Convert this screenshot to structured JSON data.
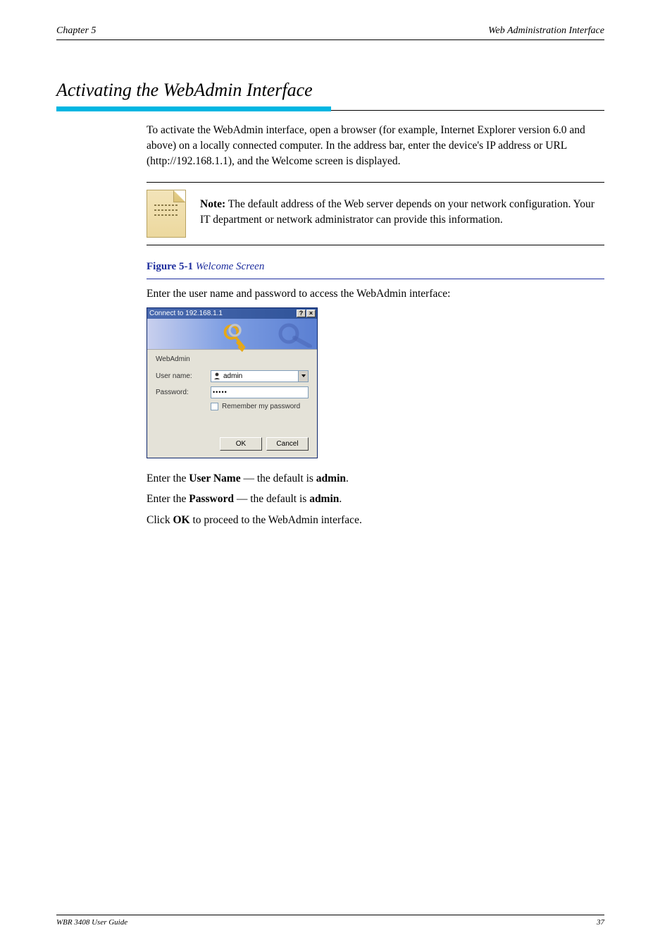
{
  "header": {
    "left": "Chapter 5",
    "right": "Web Administration Interface"
  },
  "section_title": "Activating the WebAdmin Interface",
  "body": {
    "p1_a": "To activate the WebAdmin interface, open a browser (for example, Internet Explorer version 6.0 and above) on a locally connected computer. In the address bar, enter the device's IP address or URL (",
    "p1_link": "http://192.168.1.1",
    "p1_b": "), and the Welcome screen is displayed."
  },
  "note": {
    "label": "Note:",
    "text": "The default address of the Web server depends on your network configuration. Your IT department or network administrator can provide this information."
  },
  "figure": {
    "num": "Figure 5-1",
    "caption": "Welcome Screen"
  },
  "step2": "Enter the user name and password to access the WebAdmin interface:",
  "dialog": {
    "title": "Connect to 192.168.1.1",
    "help_glyph": "?",
    "close_glyph": "×",
    "realm": "WebAdmin",
    "username_label": "User name:",
    "username_value": "admin",
    "password_label": "Password:",
    "password_value": "•••••",
    "remember_label": "Remember my password",
    "ok": "OK",
    "cancel": "Cancel"
  },
  "instructions": {
    "line1_a": "Enter the ",
    "line1_b": "User Name",
    "line1_c": " — the default is ",
    "line1_d": "admin",
    "line1_e": ".",
    "line2_a": "Enter the ",
    "line2_b": "Password",
    "line2_c": " — the default is ",
    "line2_d": "admin",
    "line2_e": ".",
    "line3_a": "Click ",
    "line3_b": "OK",
    "line3_c": " to proceed to the WebAdmin interface."
  },
  "footer": {
    "left": "WBR 3408 User Guide",
    "right": "37"
  }
}
